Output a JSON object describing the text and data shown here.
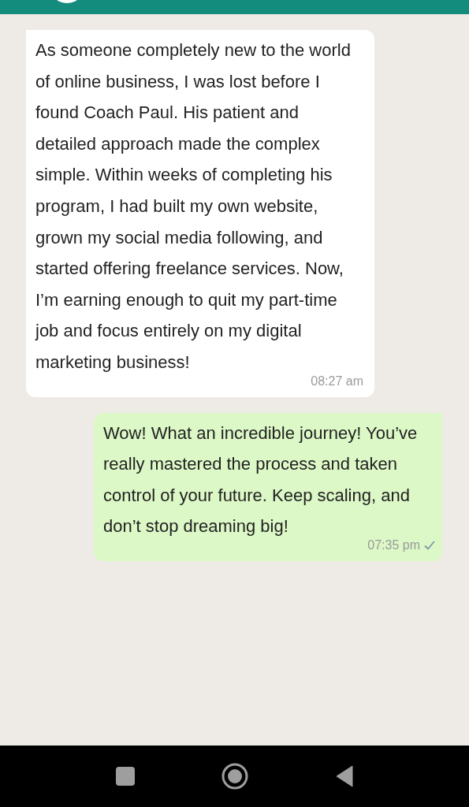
{
  "messages": [
    {
      "kind": "incoming",
      "text": "As someone completely new to the world of online business, I was lost before I found Coach Paul. His patient and detailed approach made the complex simple. Within weeks of completing his program, I had built my own website, grown my social media following, and started offering freelance services. Now, I’m earning enough to quit my part-time job and focus entirely on my digital marketing business!",
      "time": "08:27 am"
    },
    {
      "kind": "outgoing",
      "text": "Wow! What an incredible journey! You’ve really mastered the process and taken control of your future. Keep scaling, and don’t stop dreaming big!",
      "time": "07:35 pm",
      "sent": true
    }
  ]
}
